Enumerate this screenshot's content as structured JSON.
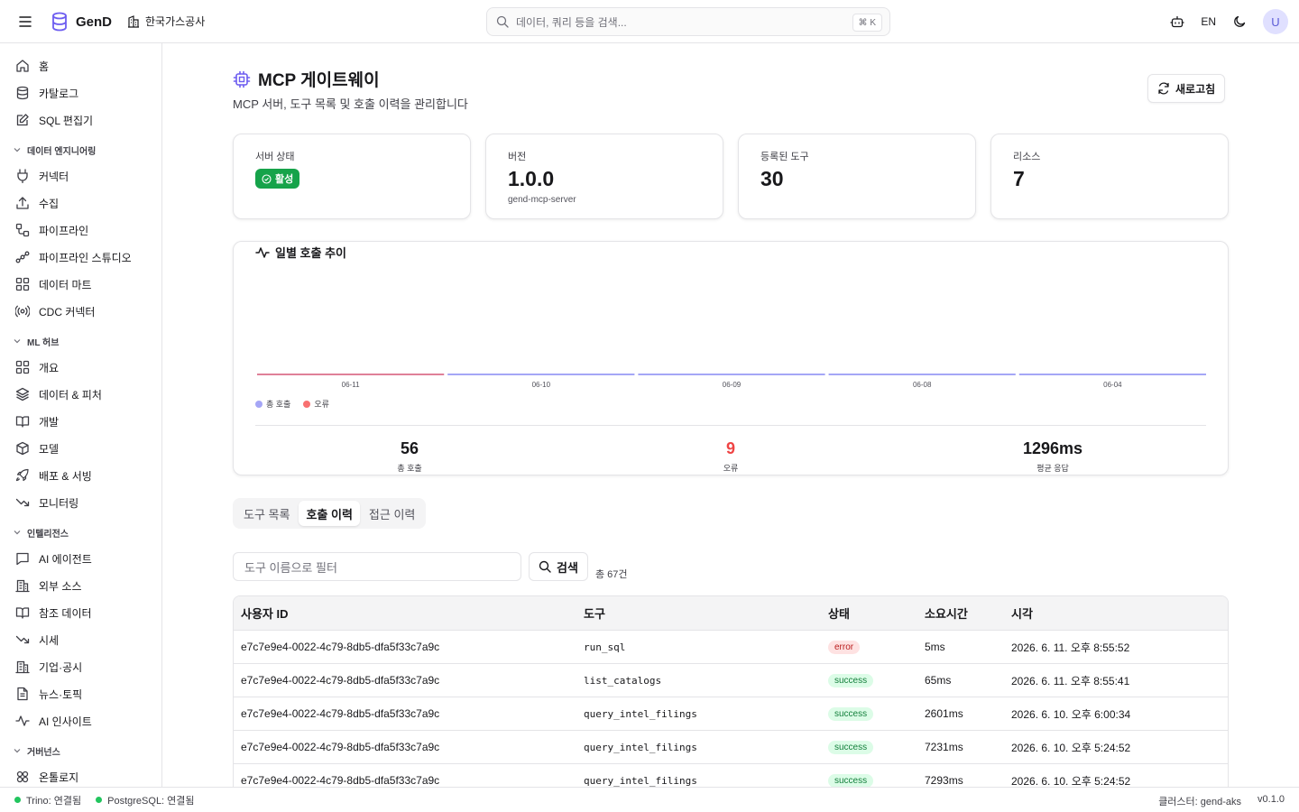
{
  "app": {
    "name": "GenD",
    "org": "한국가스공사"
  },
  "search": {
    "placeholder": "데이터, 쿼리 등을 검색...",
    "shortcut": "⌘ K"
  },
  "topbar": {
    "lang": "EN",
    "avatar": "U"
  },
  "sidebar": {
    "items_top": [
      {
        "label": "홈",
        "icon": "home-icon"
      },
      {
        "label": "카탈로그",
        "icon": "database-icon"
      },
      {
        "label": "SQL 편집기",
        "icon": "edit-icon"
      }
    ],
    "sections": [
      {
        "title": "데이터 엔지니어링",
        "items": [
          {
            "label": "커넥터",
            "icon": "plug-icon"
          },
          {
            "label": "수집",
            "icon": "upload-icon"
          },
          {
            "label": "파이프라인",
            "icon": "pipeline-icon"
          },
          {
            "label": "파이프라인 스튜디오",
            "icon": "workflow-icon"
          },
          {
            "label": "데이터 마트",
            "icon": "grid-icon"
          },
          {
            "label": "CDC 커넥터",
            "icon": "radio-icon"
          }
        ]
      },
      {
        "title": "ML 허브",
        "items": [
          {
            "label": "개요",
            "icon": "grid-icon"
          },
          {
            "label": "데이터 & 피처",
            "icon": "layers-icon"
          },
          {
            "label": "개발",
            "icon": "book-icon"
          },
          {
            "label": "모델",
            "icon": "box-icon"
          },
          {
            "label": "배포 & 서빙",
            "icon": "rocket-icon"
          },
          {
            "label": "모니터링",
            "icon": "trending-icon"
          }
        ]
      },
      {
        "title": "인텔리전스",
        "items": [
          {
            "label": "AI 에이전트",
            "icon": "chat-icon"
          },
          {
            "label": "외부 소스",
            "icon": "building-icon"
          },
          {
            "label": "참조 데이터",
            "icon": "book-icon"
          },
          {
            "label": "시세",
            "icon": "trending-icon"
          },
          {
            "label": "기업·공시",
            "icon": "building-icon"
          },
          {
            "label": "뉴스·토픽",
            "icon": "file-icon"
          },
          {
            "label": "AI 인사이트",
            "icon": "activity-icon"
          }
        ]
      },
      {
        "title": "거버넌스",
        "items": [
          {
            "label": "온톨로지",
            "icon": "ontology-icon"
          }
        ]
      }
    ]
  },
  "page": {
    "title": "MCP 게이트웨이",
    "subtitle": "MCP 서버, 도구 목록 및 호출 이력을 관리합니다",
    "refresh_label": "새로고침"
  },
  "cards": {
    "status": {
      "label": "서버 상태",
      "value": "활성"
    },
    "version": {
      "label": "버전",
      "value": "1.0.0",
      "sub": "gend-mcp-server"
    },
    "tools": {
      "label": "등록된 도구",
      "value": "30"
    },
    "resources": {
      "label": "리소스",
      "value": "7"
    }
  },
  "chart_data": {
    "type": "bar",
    "title": "일별 호출 추이",
    "categories": [
      "06-11",
      "06-10",
      "06-09",
      "06-08",
      "06-04"
    ],
    "series": [
      {
        "name": "총 호출",
        "values": [
          0,
          0,
          0,
          0,
          0
        ]
      },
      {
        "name": "오류",
        "values": [
          0,
          0,
          0,
          0,
          0
        ]
      }
    ],
    "colors": {
      "total": "#a5a6f6",
      "error": "#f87171"
    },
    "legend": "bottom-left"
  },
  "summary": {
    "total": {
      "value": "56",
      "label": "총 호출"
    },
    "errors": {
      "value": "9",
      "label": "오류"
    },
    "avg": {
      "value": "1296ms",
      "label": "평균 응답"
    }
  },
  "tabs": [
    "도구 목록",
    "호출 이력",
    "접근 이력"
  ],
  "filter": {
    "placeholder": "도구 이름으로 필터",
    "button": "검색",
    "total": "총 67건"
  },
  "table": {
    "headers": [
      "사용자 ID",
      "도구",
      "상태",
      "소요시간",
      "시각"
    ],
    "rows": [
      [
        "e7c7e9e4-0022-4c79-8db5-dfa5f33c7a9c",
        "run_sql",
        "error",
        "5ms",
        "2026. 6. 11. 오후 8:55:52"
      ],
      [
        "e7c7e9e4-0022-4c79-8db5-dfa5f33c7a9c",
        "list_catalogs",
        "success",
        "65ms",
        "2026. 6. 11. 오후 8:55:41"
      ],
      [
        "e7c7e9e4-0022-4c79-8db5-dfa5f33c7a9c",
        "query_intel_filings",
        "success",
        "2601ms",
        "2026. 6. 10. 오후 6:00:34"
      ],
      [
        "e7c7e9e4-0022-4c79-8db5-dfa5f33c7a9c",
        "query_intel_filings",
        "success",
        "7231ms",
        "2026. 6. 10. 오후 5:24:52"
      ],
      [
        "e7c7e9e4-0022-4c79-8db5-dfa5f33c7a9c",
        "query_intel_filings",
        "success",
        "7293ms",
        "2026. 6. 10. 오후 5:24:52"
      ]
    ]
  },
  "statusbar": {
    "trino": "Trino: 연결됨",
    "postgres": "PostgreSQL: 연결됨",
    "cluster": "클러스터: gend-aks",
    "version": "v0.1.0"
  }
}
